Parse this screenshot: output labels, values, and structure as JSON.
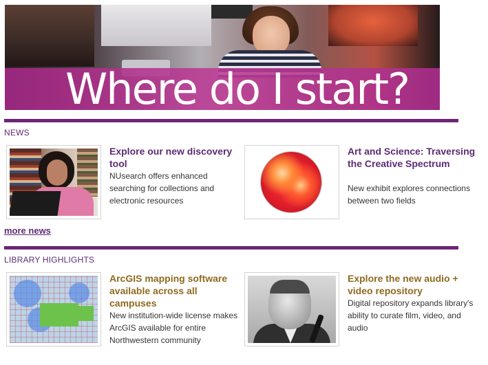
{
  "hero": {
    "title": "Where do I start?"
  },
  "news": {
    "section_label": "NEWS",
    "items": [
      {
        "title": "Explore our new discovery tool",
        "description": "NUsearch offers enhanced searching for collections and electronic resources"
      },
      {
        "title": "Art and Science: Traversing the Creative Spectrum",
        "description": "New exhibit explores connections between two fields"
      }
    ],
    "more_label": "more news"
  },
  "highlights": {
    "section_label": "LIBRARY HIGHLIGHTS",
    "items": [
      {
        "title": "ArcGIS mapping software available across all campuses",
        "description": "New institution-wide license makes ArcGIS available for entire Northwestern community"
      },
      {
        "title": "Explore the new audio + video repository",
        "description": "Digital repository expands library's ability to curate film, video, and audio"
      }
    ]
  },
  "colors": {
    "accent_purple": "#6d2577",
    "title_purple": "#5e2a73",
    "title_gold": "#8e6a1f",
    "hero_band": "#b03c96"
  },
  "icons": [
    "hero-photo",
    "discovery-thumbnail",
    "art-disc-thumbnail",
    "map-thumbnail",
    "portrait-thumbnail"
  ]
}
